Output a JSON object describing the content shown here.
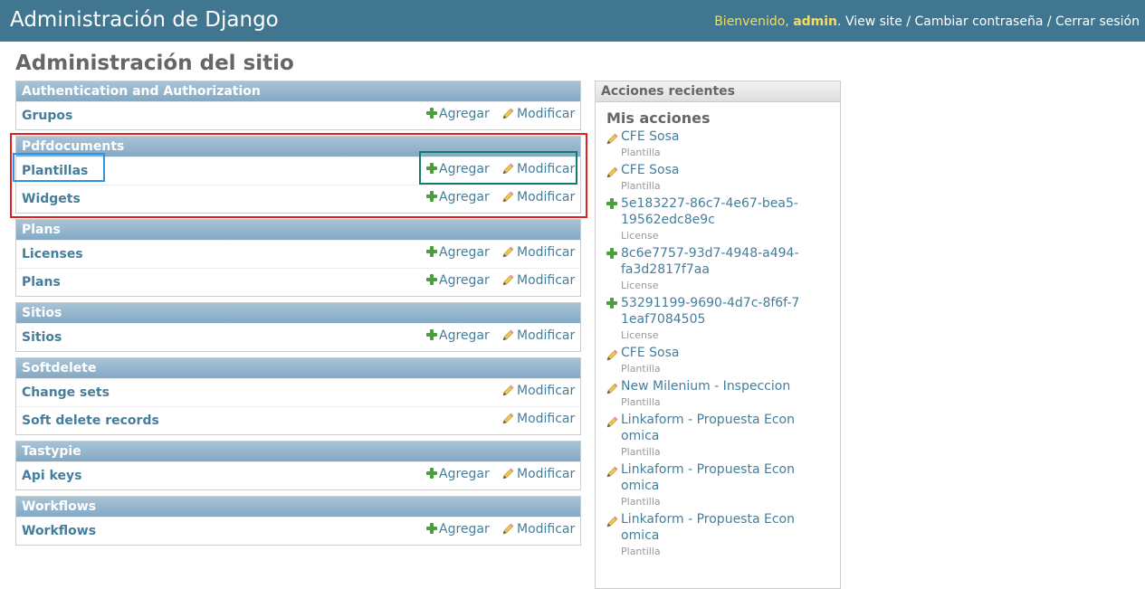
{
  "header": {
    "branding": "Administración de Django",
    "welcome": "Bienvenido,",
    "username": "admin",
    "view_site": "View site",
    "change_password": "Cambiar contraseña",
    "logout": "Cerrar sesión",
    "separator": " / "
  },
  "page_title": "Administración del sitio",
  "labels": {
    "add": "Agregar",
    "change": "Modificar"
  },
  "apps": [
    {
      "name": "Authentication and Authorization",
      "models": [
        {
          "name": "Grupos",
          "add": true
        }
      ]
    },
    {
      "name": "Pdfdocuments",
      "models": [
        {
          "name": "Plantillas",
          "add": true
        },
        {
          "name": "Widgets",
          "add": true
        }
      ]
    },
    {
      "name": "Plans",
      "models": [
        {
          "name": "Licenses",
          "add": true
        },
        {
          "name": "Plans",
          "add": true
        }
      ]
    },
    {
      "name": "Sitios",
      "models": [
        {
          "name": "Sitios",
          "add": true
        }
      ]
    },
    {
      "name": "Softdelete",
      "models": [
        {
          "name": "Change sets",
          "add": false
        },
        {
          "name": "Soft delete records",
          "add": false
        }
      ]
    },
    {
      "name": "Tastypie",
      "models": [
        {
          "name": "Api keys",
          "add": true
        }
      ]
    },
    {
      "name": "Workflows",
      "models": [
        {
          "name": "Workflows",
          "add": true
        }
      ]
    }
  ],
  "recent_actions": {
    "title": "Acciones recientes",
    "subtitle": "Mis acciones",
    "items": [
      {
        "action": "change",
        "object": "CFE Sosa",
        "type": "Plantilla"
      },
      {
        "action": "change",
        "object": "CFE Sosa",
        "type": "Plantilla"
      },
      {
        "action": "add",
        "object": "5e183227-86c7-4e67-bea5-19562edc8e9c",
        "type": "License"
      },
      {
        "action": "add",
        "object": "8c6e7757-93d7-4948-a494-fa3d2817f7aa",
        "type": "License"
      },
      {
        "action": "add",
        "object": "53291199-9690-4d7c-8f6f-71eaf7084505",
        "type": "License"
      },
      {
        "action": "change",
        "object": "CFE Sosa",
        "type": "Plantilla"
      },
      {
        "action": "change",
        "object": "New Milenium - Inspeccion",
        "type": "Plantilla"
      },
      {
        "action": "change",
        "object": "Linkaform - Propuesta Economica",
        "type": "Plantilla"
      },
      {
        "action": "change",
        "object": "Linkaform - Propuesta Economica",
        "type": "Plantilla"
      },
      {
        "action": "change",
        "object": "Linkaform - Propuesta Economica",
        "type": "Plantilla"
      }
    ]
  },
  "colors": {
    "header_bg": "#417690",
    "link": "#447e9b",
    "highlight_red": "#e02020",
    "highlight_blue": "#2b95e8",
    "highlight_green": "#127a6e"
  }
}
